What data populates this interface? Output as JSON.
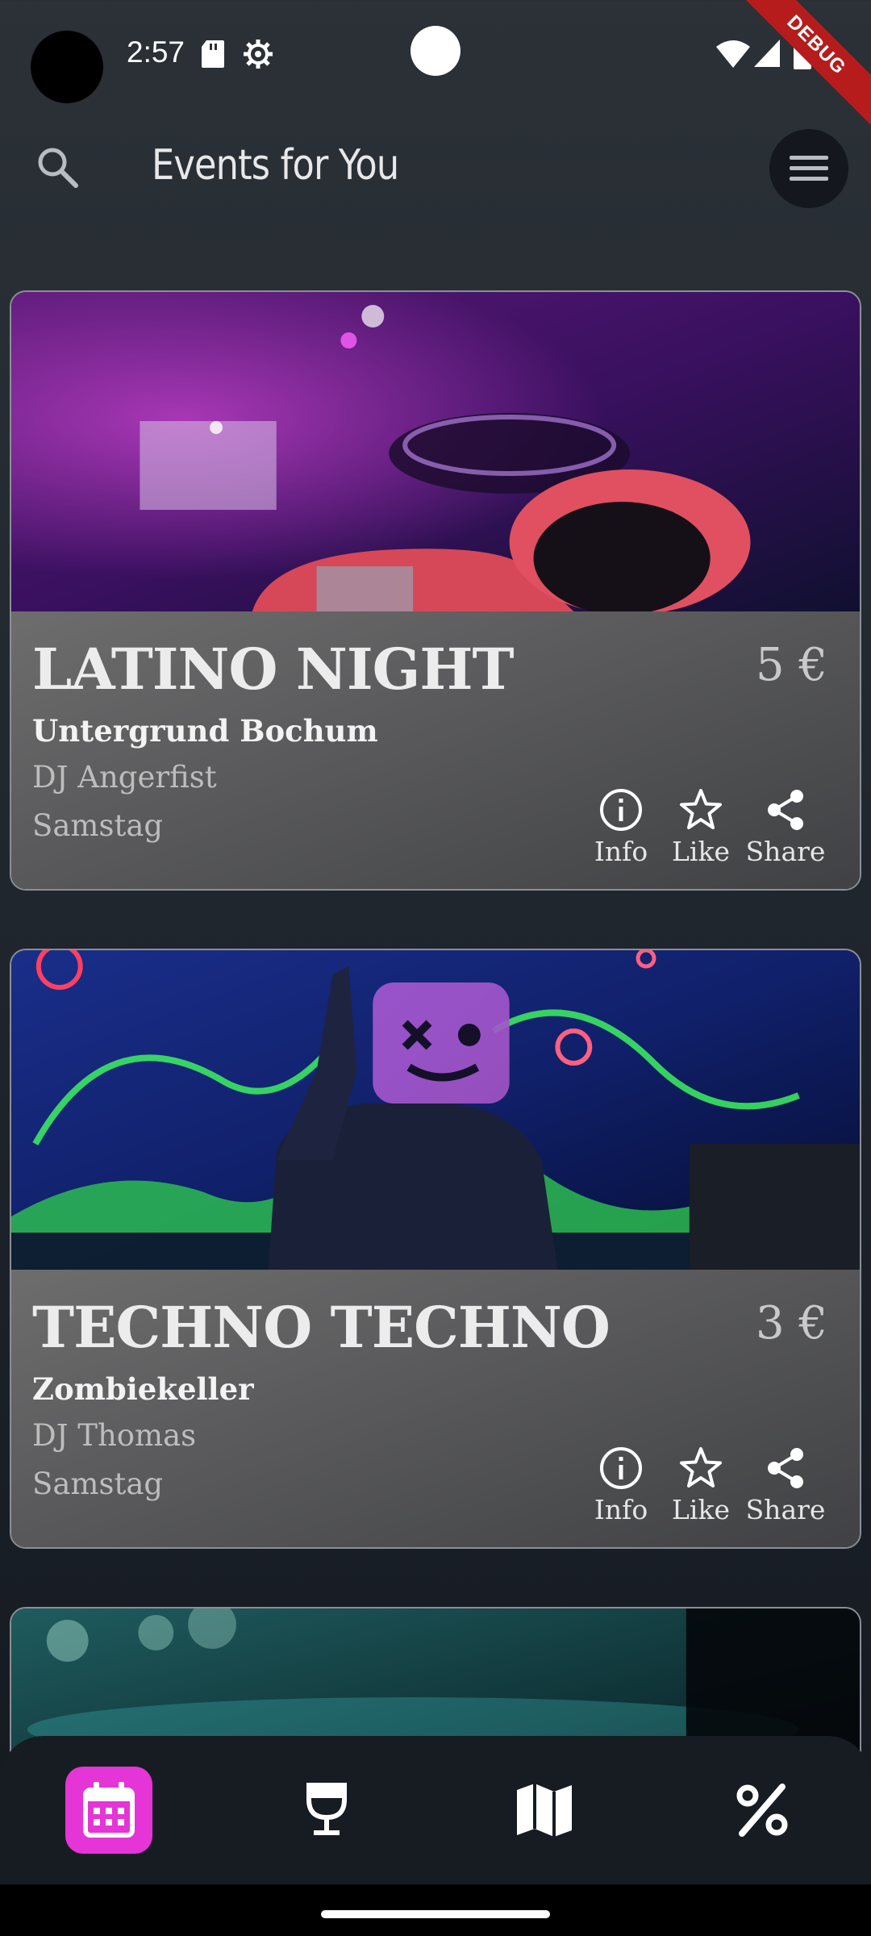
{
  "status_bar": {
    "time": "2:57",
    "debug_label": "DEBUG"
  },
  "app_bar": {
    "title": "Events for You"
  },
  "events": [
    {
      "title": "LATINO NIGHT",
      "price": "5 €",
      "venue": "Untergrund Bochum",
      "dj": "DJ Angerfist",
      "day": "Samstag"
    },
    {
      "title": "TECHNO TECHNO",
      "price": "3 €",
      "venue": "Zombiekeller",
      "dj": "DJ Thomas",
      "day": "Samstag"
    }
  ],
  "actions": {
    "info": "Info",
    "like": "Like",
    "share": "Share"
  },
  "bottom_nav": {
    "items": [
      {
        "icon": "calendar-icon",
        "active": true
      },
      {
        "icon": "wine-glass-icon",
        "active": false
      },
      {
        "icon": "map-icon",
        "active": false
      },
      {
        "icon": "percent-icon",
        "active": false
      }
    ]
  },
  "colors": {
    "accent": "#e535d6",
    "background": "#242a31",
    "card": "#5b5b5d"
  }
}
